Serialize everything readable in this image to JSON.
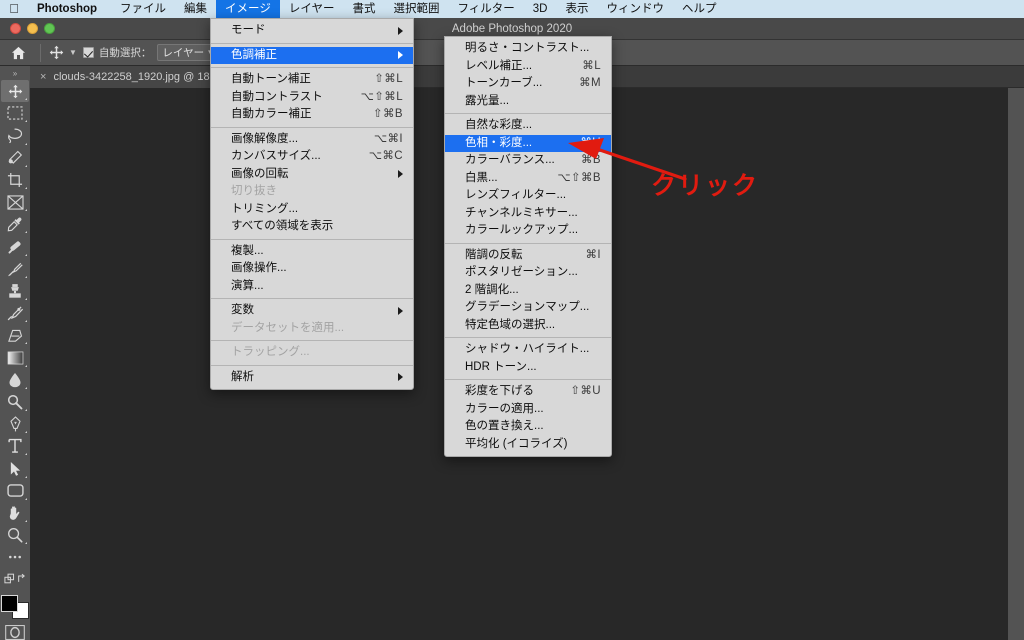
{
  "macmenu": {
    "apple_icon": "apple-icon",
    "items": [
      {
        "label": "Photoshop",
        "bold": true,
        "active": false
      },
      {
        "label": "ファイル",
        "bold": false,
        "active": false
      },
      {
        "label": "編集",
        "bold": false,
        "active": false
      },
      {
        "label": "イメージ",
        "bold": false,
        "active": true
      },
      {
        "label": "レイヤー",
        "bold": false,
        "active": false
      },
      {
        "label": "書式",
        "bold": false,
        "active": false
      },
      {
        "label": "選択範囲",
        "bold": false,
        "active": false
      },
      {
        "label": "フィルター",
        "bold": false,
        "active": false
      },
      {
        "label": "3D",
        "bold": false,
        "active": false
      },
      {
        "label": "表示",
        "bold": false,
        "active": false
      },
      {
        "label": "ウィンドウ",
        "bold": false,
        "active": false
      },
      {
        "label": "ヘルプ",
        "bold": false,
        "active": false
      }
    ]
  },
  "window": {
    "title": "Adobe Photoshop 2020",
    "close_label": "",
    "minimize_label": "",
    "zoom_label": ""
  },
  "options_bar": {
    "home_icon": "home-icon",
    "tool_icon": "move-tool-icon",
    "auto_select_label": "自動選択：",
    "auto_select_checked": true,
    "layer_select_value": "レイヤー",
    "right_icons": [
      "align-icon",
      "distribute-icon",
      "three-d-mode-icon",
      "three-d-pan-icon",
      "three-d-camera-icon"
    ]
  },
  "document_tab": {
    "close_icon": "close-icon",
    "label": "clouds-3422258_1920.jpg @ 18"
  },
  "toolbar": {
    "grip_label": "»",
    "tools": [
      {
        "name": "move-tool",
        "selected": true
      },
      {
        "name": "marquee-tool",
        "selected": false
      },
      {
        "name": "lasso-tool",
        "selected": false
      },
      {
        "name": "quick-selection-tool",
        "selected": false
      },
      {
        "name": "crop-tool",
        "selected": false
      },
      {
        "name": "frame-tool",
        "selected": false
      },
      {
        "name": "eyedropper-tool",
        "selected": false
      },
      {
        "name": "healing-brush-tool",
        "selected": false
      },
      {
        "name": "brush-tool",
        "selected": false
      },
      {
        "name": "clone-stamp-tool",
        "selected": false
      },
      {
        "name": "history-brush-tool",
        "selected": false
      },
      {
        "name": "eraser-tool",
        "selected": false
      },
      {
        "name": "gradient-tool",
        "selected": false
      },
      {
        "name": "blur-tool",
        "selected": false
      },
      {
        "name": "dodge-tool",
        "selected": false
      },
      {
        "name": "pen-tool",
        "selected": false
      },
      {
        "name": "type-tool",
        "selected": false
      },
      {
        "name": "path-selection-tool",
        "selected": false
      },
      {
        "name": "rectangle-tool",
        "selected": false
      },
      {
        "name": "hand-tool",
        "selected": false
      },
      {
        "name": "zoom-tool",
        "selected": false
      },
      {
        "name": "edit-toolbar",
        "selected": false
      }
    ],
    "swap_colors_icon": "swap-colors-icon",
    "default_colors_icon": "default-colors-icon",
    "foreground_color": "#000000",
    "background_color": "#ffffff",
    "quick_mask_icon": "quick-mask-icon"
  },
  "image_menu": {
    "items": [
      {
        "label": "モード",
        "shortcut": "",
        "submenu": true,
        "highlighted": false,
        "disabled": false
      },
      {
        "sep": true
      },
      {
        "label": "色調補正",
        "shortcut": "",
        "submenu": true,
        "highlighted": true,
        "disabled": false
      },
      {
        "sep": true
      },
      {
        "label": "自動トーン補正",
        "shortcut": "⇧⌘L",
        "submenu": false,
        "highlighted": false,
        "disabled": false
      },
      {
        "label": "自動コントラスト",
        "shortcut": "⌥⇧⌘L",
        "submenu": false,
        "highlighted": false,
        "disabled": false
      },
      {
        "label": "自動カラー補正",
        "shortcut": "⇧⌘B",
        "submenu": false,
        "highlighted": false,
        "disabled": false
      },
      {
        "sep": true
      },
      {
        "label": "画像解像度...",
        "shortcut": "⌥⌘I",
        "submenu": false,
        "highlighted": false,
        "disabled": false
      },
      {
        "label": "カンバスサイズ...",
        "shortcut": "⌥⌘C",
        "submenu": false,
        "highlighted": false,
        "disabled": false
      },
      {
        "label": "画像の回転",
        "shortcut": "",
        "submenu": true,
        "highlighted": false,
        "disabled": false
      },
      {
        "label": "切り抜き",
        "shortcut": "",
        "submenu": false,
        "highlighted": false,
        "disabled": true
      },
      {
        "label": "トリミング...",
        "shortcut": "",
        "submenu": false,
        "highlighted": false,
        "disabled": false
      },
      {
        "label": "すべての領域を表示",
        "shortcut": "",
        "submenu": false,
        "highlighted": false,
        "disabled": false
      },
      {
        "sep": true
      },
      {
        "label": "複製...",
        "shortcut": "",
        "submenu": false,
        "highlighted": false,
        "disabled": false
      },
      {
        "label": "画像操作...",
        "shortcut": "",
        "submenu": false,
        "highlighted": false,
        "disabled": false
      },
      {
        "label": "演算...",
        "shortcut": "",
        "submenu": false,
        "highlighted": false,
        "disabled": false
      },
      {
        "sep": true
      },
      {
        "label": "変数",
        "shortcut": "",
        "submenu": true,
        "highlighted": false,
        "disabled": false
      },
      {
        "label": "データセットを適用...",
        "shortcut": "",
        "submenu": false,
        "highlighted": false,
        "disabled": true
      },
      {
        "sep": true
      },
      {
        "label": "トラッピング...",
        "shortcut": "",
        "submenu": false,
        "highlighted": false,
        "disabled": true
      },
      {
        "sep": true
      },
      {
        "label": "解析",
        "shortcut": "",
        "submenu": true,
        "highlighted": false,
        "disabled": false
      }
    ]
  },
  "adjustments_submenu": {
    "items": [
      {
        "label": "明るさ・コントラスト...",
        "shortcut": "",
        "submenu": false,
        "highlighted": false,
        "disabled": false
      },
      {
        "label": "レベル補正...",
        "shortcut": "⌘L",
        "submenu": false,
        "highlighted": false,
        "disabled": false
      },
      {
        "label": "トーンカーブ...",
        "shortcut": "⌘M",
        "submenu": false,
        "highlighted": false,
        "disabled": false
      },
      {
        "label": "露光量...",
        "shortcut": "",
        "submenu": false,
        "highlighted": false,
        "disabled": false
      },
      {
        "sep": true
      },
      {
        "label": "自然な彩度...",
        "shortcut": "",
        "submenu": false,
        "highlighted": false,
        "disabled": false
      },
      {
        "label": "色相・彩度...",
        "shortcut": "⌘U",
        "submenu": false,
        "highlighted": true,
        "disabled": false
      },
      {
        "label": "カラーバランス...",
        "shortcut": "⌘B",
        "submenu": false,
        "highlighted": false,
        "disabled": false
      },
      {
        "label": "白黒...",
        "shortcut": "⌥⇧⌘B",
        "submenu": false,
        "highlighted": false,
        "disabled": false
      },
      {
        "label": "レンズフィルター...",
        "shortcut": "",
        "submenu": false,
        "highlighted": false,
        "disabled": false
      },
      {
        "label": "チャンネルミキサー...",
        "shortcut": "",
        "submenu": false,
        "highlighted": false,
        "disabled": false
      },
      {
        "label": "カラールックアップ...",
        "shortcut": "",
        "submenu": false,
        "highlighted": false,
        "disabled": false
      },
      {
        "sep": true
      },
      {
        "label": "階調の反転",
        "shortcut": "⌘I",
        "submenu": false,
        "highlighted": false,
        "disabled": false
      },
      {
        "label": "ポスタリゼーション...",
        "shortcut": "",
        "submenu": false,
        "highlighted": false,
        "disabled": false
      },
      {
        "label": "2 階調化...",
        "shortcut": "",
        "submenu": false,
        "highlighted": false,
        "disabled": false
      },
      {
        "label": "グラデーションマップ...",
        "shortcut": "",
        "submenu": false,
        "highlighted": false,
        "disabled": false
      },
      {
        "label": "特定色域の選択...",
        "shortcut": "",
        "submenu": false,
        "highlighted": false,
        "disabled": false
      },
      {
        "sep": true
      },
      {
        "label": "シャドウ・ハイライト...",
        "shortcut": "",
        "submenu": false,
        "highlighted": false,
        "disabled": false
      },
      {
        "label": "HDR トーン...",
        "shortcut": "",
        "submenu": false,
        "highlighted": false,
        "disabled": false
      },
      {
        "sep": true
      },
      {
        "label": "彩度を下げる",
        "shortcut": "⇧⌘U",
        "submenu": false,
        "highlighted": false,
        "disabled": false
      },
      {
        "label": "カラーの適用...",
        "shortcut": "",
        "submenu": false,
        "highlighted": false,
        "disabled": false
      },
      {
        "label": "色の置き換え...",
        "shortcut": "",
        "submenu": false,
        "highlighted": false,
        "disabled": false
      },
      {
        "label": "平均化 (イコライズ)",
        "shortcut": "",
        "submenu": false,
        "highlighted": false,
        "disabled": false
      }
    ]
  },
  "annotation": {
    "text": "クリック",
    "color": "#e11b10",
    "arrow_name": "red-pointer-arrow"
  },
  "colors": {
    "menu_highlight": "#1c6ff0",
    "macbar_bg": "#cfe3f0",
    "panel_bg": "#535353",
    "canvas_bg": "#282828",
    "annotation_red": "#e11b10"
  }
}
